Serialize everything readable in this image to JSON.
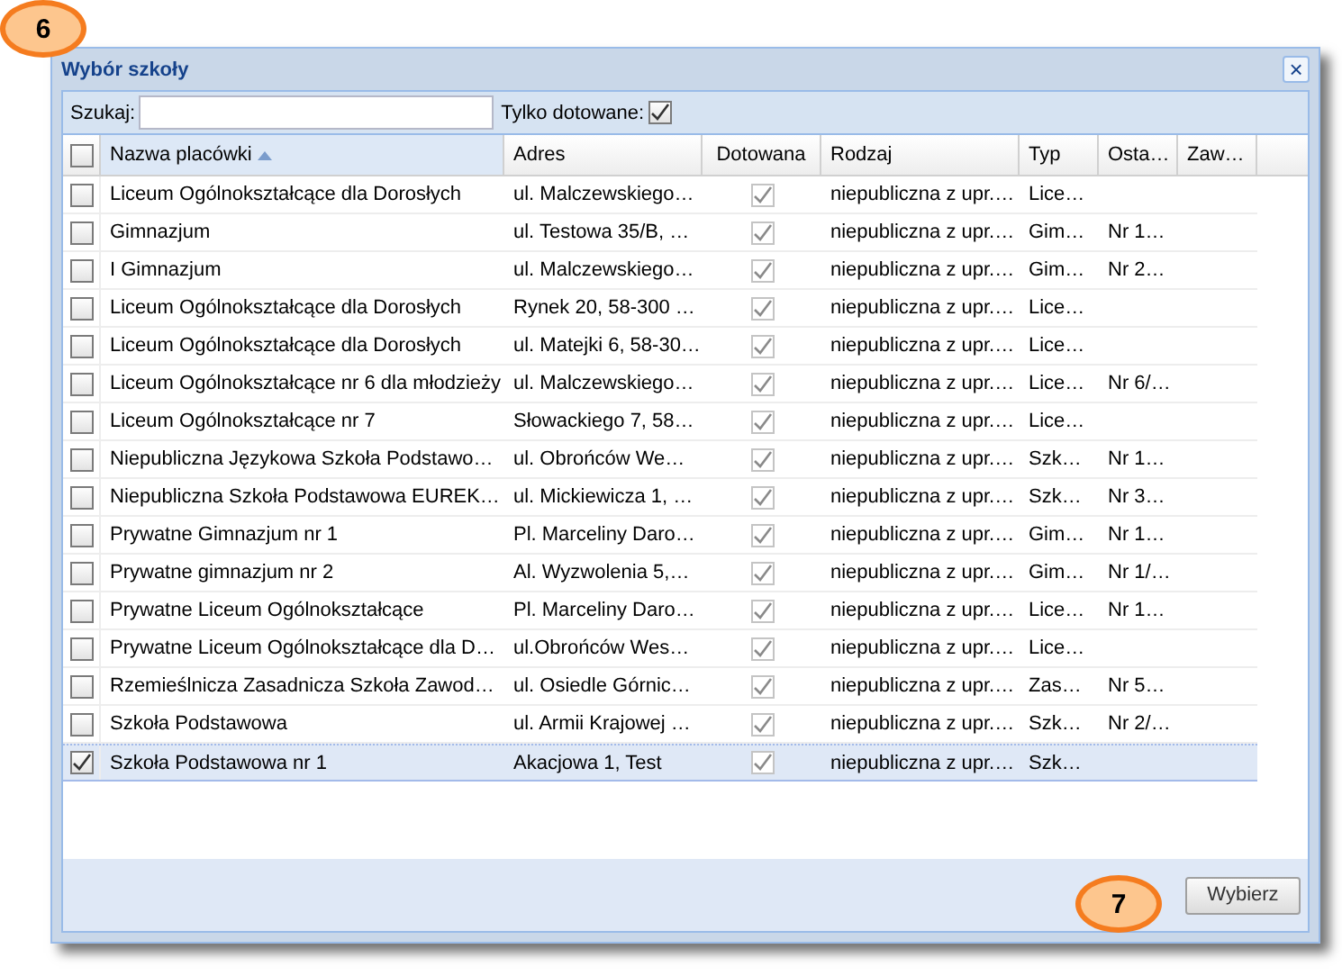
{
  "callouts": [
    {
      "label": "6"
    },
    {
      "label": "7"
    }
  ],
  "window": {
    "title": "Wybór szkoły",
    "close": "×"
  },
  "toolbar": {
    "search_label": "Szukaj:",
    "only_subsidized_label": "Tylko dotowane:",
    "only_subsidized": true
  },
  "table": {
    "select_all": false,
    "columns": [
      {
        "label": "Nazwa placówki",
        "sorted": true
      },
      {
        "label": "Adres",
        "sorted": false
      },
      {
        "label": "Dotowana",
        "sorted": false
      },
      {
        "label": "Rodzaj",
        "sorted": false
      },
      {
        "label": "Typ",
        "sorted": false
      },
      {
        "label": "Osta…",
        "sorted": false
      },
      {
        "label": "Zaw…",
        "sorted": false
      }
    ],
    "rows": [
      {
        "checked": false,
        "selected": false,
        "name": "Liceum Ogólnokształcące dla Dorosłych",
        "address": "ul. Malczewskiego…",
        "subsidized": true,
        "kind": "niepubliczna z upr.…",
        "type": "Lice…"
      },
      {
        "checked": false,
        "selected": false,
        "name": "Gimnazjum",
        "address": "ul. Testowa 35/B, …",
        "subsidized": true,
        "kind": "niepubliczna z upr.…",
        "type": "Gim…",
        "column_6": "Nr 1…"
      },
      {
        "checked": false,
        "selected": false,
        "name": "I Gimnazjum",
        "address": "ul. Malczewskiego…",
        "subsidized": true,
        "kind": "niepubliczna z upr.…",
        "type": "Gim…",
        "column_6": "Nr 2…"
      },
      {
        "checked": false,
        "selected": false,
        "name": "Liceum Ogólnokształcące dla Dorosłych",
        "address": "Rynek 20, 58-300 …",
        "subsidized": true,
        "kind": "niepubliczna z upr.…",
        "type": "Lice…"
      },
      {
        "checked": false,
        "selected": false,
        "name": "Liceum Ogólnokształcące dla Dorosłych",
        "address": "ul. Matejki 6, 58-30…",
        "subsidized": true,
        "kind": "niepubliczna z upr.…",
        "type": "Lice…"
      },
      {
        "checked": false,
        "selected": false,
        "name": "Liceum Ogólnokształcące nr 6 dla młodzieży",
        "address": "ul. Malczewskiego…",
        "subsidized": true,
        "kind": "niepubliczna z upr.…",
        "type": "Lice…",
        "column_6": "Nr 6/…"
      },
      {
        "checked": false,
        "selected": false,
        "name": "Liceum Ogólnokształcące nr 7",
        "address": "Słowackiego 7, 58…",
        "subsidized": true,
        "kind": "niepubliczna z upr.…",
        "type": "Lice…"
      },
      {
        "checked": false,
        "selected": false,
        "name": "Niepubliczna Językowa Szkoła Podstawo…",
        "address": "ul. Obrońców We…",
        "subsidized": true,
        "kind": "niepubliczna z upr.…",
        "type": "Szk…",
        "column_6": "Nr 1…"
      },
      {
        "checked": false,
        "selected": false,
        "name": "Niepubliczna Szkoła Podstawowa EUREK…",
        "address": "ul. Mickiewicza 1, …",
        "subsidized": true,
        "kind": "niepubliczna z upr.…",
        "type": "Szk…",
        "column_6": "Nr 3…"
      },
      {
        "checked": false,
        "selected": false,
        "name": "Prywatne Gimnazjum nr 1",
        "address": "Pl. Marceliny Daro…",
        "subsidized": true,
        "kind": "niepubliczna z upr.…",
        "type": "Gim…",
        "column_6": "Nr 1…"
      },
      {
        "checked": false,
        "selected": false,
        "name": "Prywatne gimnazjum nr 2",
        "address": "Al. Wyzwolenia 5,…",
        "subsidized": true,
        "kind": "niepubliczna z upr.…",
        "type": "Gim…",
        "column_6": "Nr 1/…"
      },
      {
        "checked": false,
        "selected": false,
        "name": "Prywatne Liceum Ogólnokształcące",
        "address": "Pl. Marceliny Daro…",
        "subsidized": true,
        "kind": "niepubliczna z upr.…",
        "type": "Lice…",
        "column_6": "Nr 1…"
      },
      {
        "checked": false,
        "selected": false,
        "name": "Prywatne Liceum Ogólnokształcące dla D…",
        "address": "ul.Obrońców Wes…",
        "subsidized": true,
        "kind": "niepubliczna z upr.…",
        "type": "Lice…"
      },
      {
        "checked": false,
        "selected": false,
        "name": "Rzemieślnicza Zasadnicza Szkoła Zawod…",
        "address": "ul. Osiedle Górnic…",
        "subsidized": true,
        "kind": "niepubliczna z upr.…",
        "type": "Zas…",
        "column_6": "Nr 5…"
      },
      {
        "checked": false,
        "selected": false,
        "name": "Szkoła Podstawowa",
        "address": "ul. Armii Krajowej …",
        "subsidized": true,
        "kind": "niepubliczna z upr.…",
        "type": "Szk…",
        "column_6": "Nr 2/…"
      },
      {
        "checked": true,
        "selected": true,
        "name": "Szkoła Podstawowa nr 1",
        "address": "Akacjowa 1, Test",
        "subsidized": true,
        "kind": "niepubliczna z upr.…",
        "type": "Szk…"
      }
    ]
  },
  "footer": {
    "button": "Wybierz"
  }
}
